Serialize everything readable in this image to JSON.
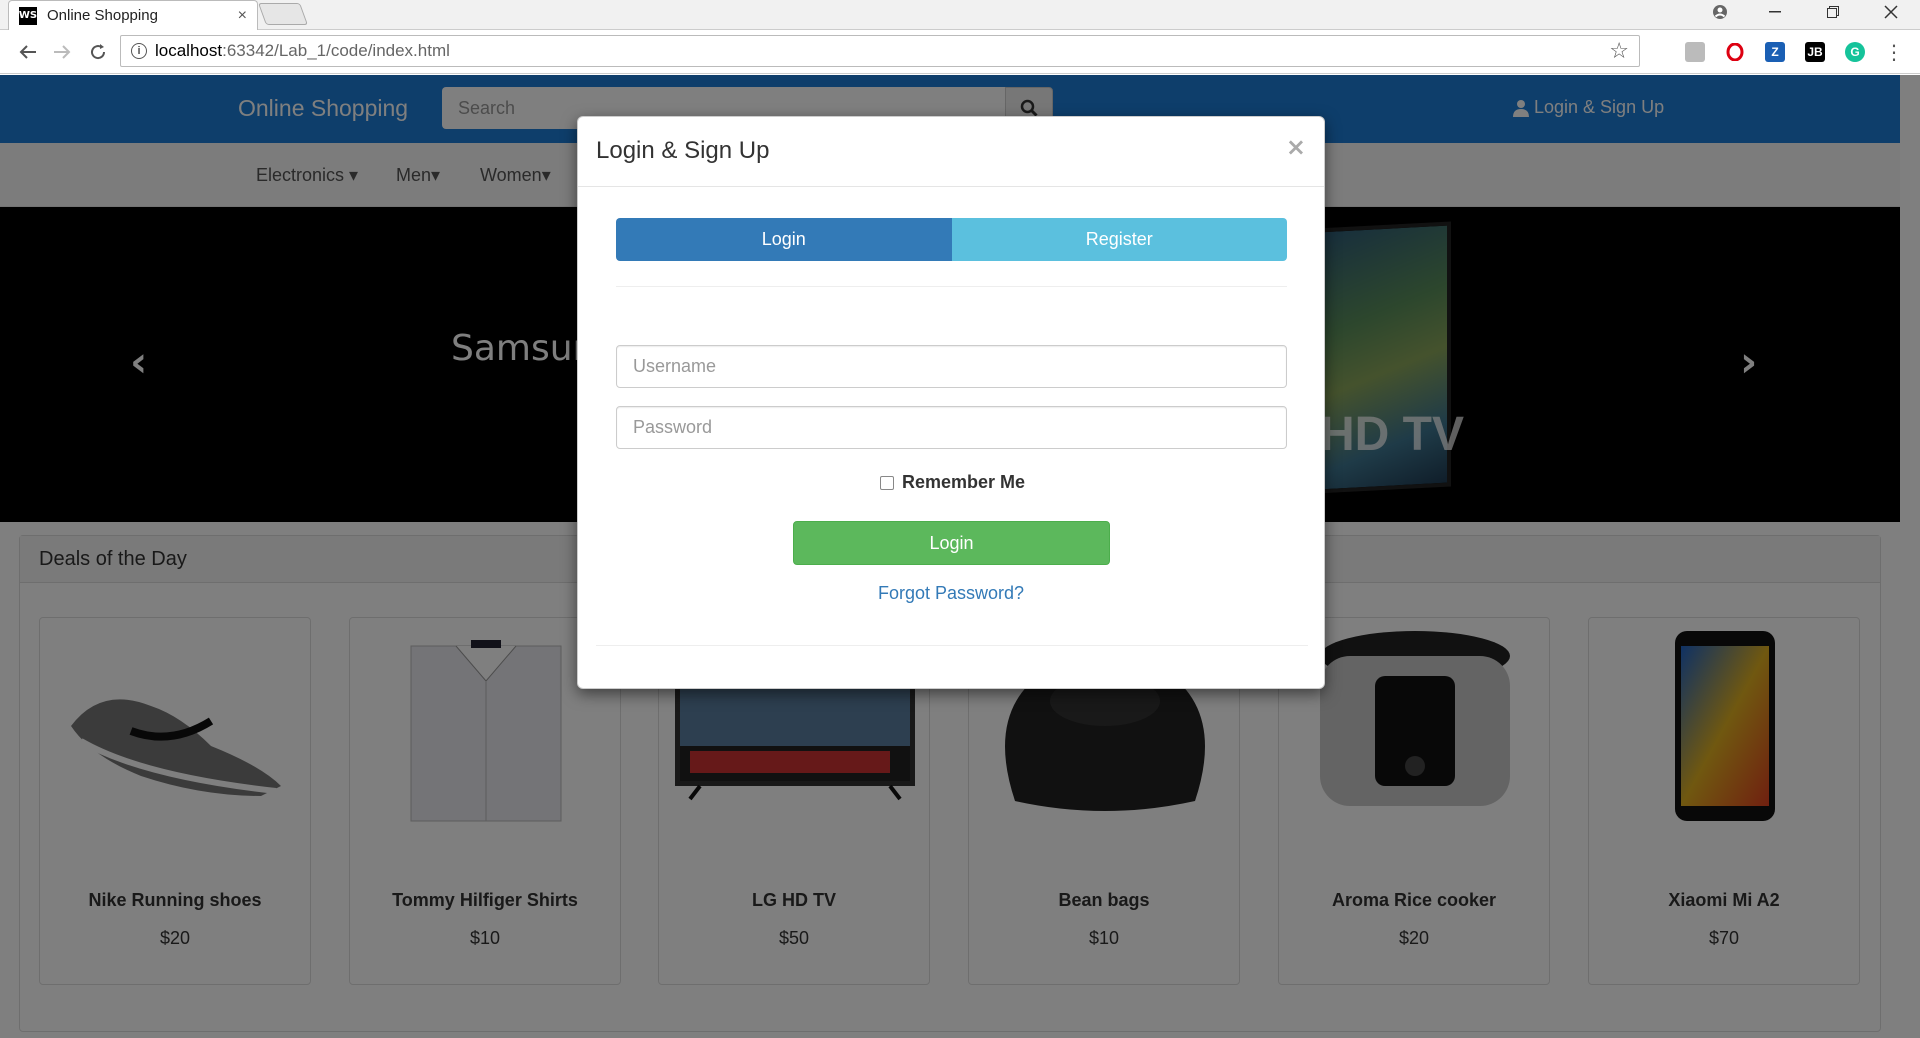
{
  "browser": {
    "tab_title": "Online Shopping",
    "tab_close": "×",
    "favicon": "WS",
    "url_host": "localhost",
    "url_path": ":63342/Lab_1/code/index.html"
  },
  "site": {
    "brand": "Online Shopping",
    "search_placeholder": "Search",
    "login_link": "Login & Sign Up",
    "nav": [
      "Electronics",
      "Men",
      "Women"
    ],
    "carousel_caption": "Samsun",
    "carousel_tv_text": "HD TV"
  },
  "deals": {
    "title": "Deals of the Day",
    "products": [
      {
        "name": "Nike Running shoes",
        "price": "$20"
      },
      {
        "name": "Tommy Hilfiger Shirts",
        "price": "$10"
      },
      {
        "name": "LG HD TV",
        "price": "$50"
      },
      {
        "name": "Bean bags",
        "price": "$10"
      },
      {
        "name": "Aroma Rice cooker",
        "price": "$20"
      },
      {
        "name": "Xiaomi Mi A2",
        "price": "$70"
      }
    ]
  },
  "modal": {
    "title": "Login & Sign Up",
    "close": "×",
    "tab_login": "Login",
    "tab_register": "Register",
    "username_placeholder": "Username",
    "password_placeholder": "Password",
    "remember_label": "Remember Me",
    "submit_label": "Login",
    "forgot_label": "Forgot Password?"
  },
  "colors": {
    "navbar": "#1d7cd6",
    "tab_active": "#337ab7",
    "tab_inactive": "#5bc0de",
    "login_button": "#5cb85c"
  }
}
